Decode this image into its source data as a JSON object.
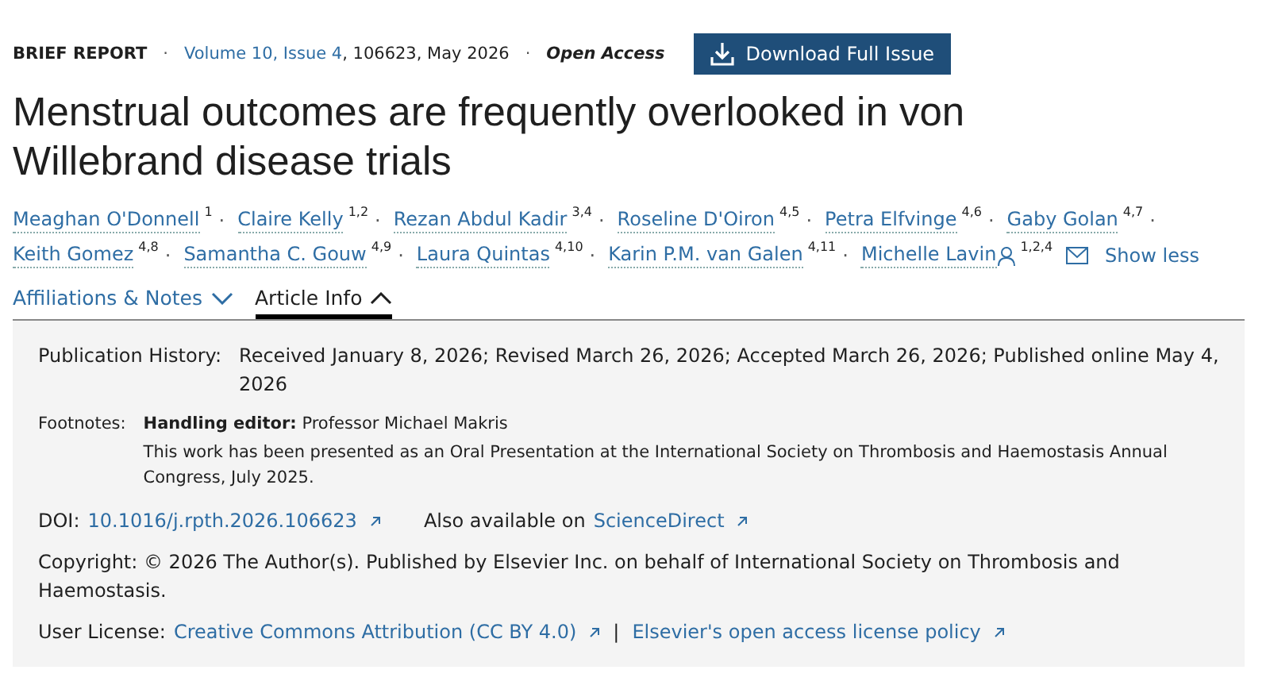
{
  "meta": {
    "type": "BRIEF REPORT",
    "separator": "·",
    "volume": "Volume 10, Issue 4",
    "details": ", 106623, May 2026",
    "access": "Open Access",
    "download_button": "Download Full Issue"
  },
  "title": "Menstrual outcomes are frequently overlooked in von Willebrand disease trials",
  "author_separator": "·",
  "authors": [
    {
      "kind": "author",
      "name": "Meaghan O'Donnell",
      "affiliations": "1"
    },
    {
      "kind": "author",
      "name": "Claire Kelly",
      "affiliations": "1,2"
    },
    {
      "kind": "author",
      "name": "Rezan Abdul Kadir",
      "affiliations": "3,4"
    },
    {
      "kind": "author",
      "name": "Roseline D'Oiron",
      "affiliations": "4,5"
    },
    {
      "kind": "author",
      "name": "Petra Elfvinge",
      "affiliations": "4,6"
    },
    {
      "kind": "author",
      "name": "Gaby Golan",
      "affiliations": "4,7"
    },
    {
      "kind": "author",
      "name": "Keith Gomez",
      "affiliations": "4,8"
    },
    {
      "kind": "author",
      "name": "Samantha C. Gouw",
      "affiliations": "4,9"
    },
    {
      "kind": "author",
      "name": "Laura Quintas",
      "affiliations": "4,10"
    },
    {
      "kind": "author",
      "name": "Karin P.M. van Galen",
      "affiliations": "4,11"
    },
    {
      "kind": "corresponding",
      "name": "Michelle Lavin",
      "affiliations": "1,2,4"
    }
  ],
  "show_less": "Show less",
  "tabs": [
    {
      "label": "Affiliations & Notes",
      "selected": false,
      "expanded": false
    },
    {
      "label": "Article Info",
      "selected": true,
      "expanded": true
    }
  ],
  "article_info": {
    "publication_history": {
      "label": "Publication History:",
      "value": "Received January 8, 2026; Revised March 26, 2026; Accepted March 26, 2026; Published online May 4, 2026"
    },
    "footnotes": {
      "label": "Footnotes:",
      "notes": [
        "**Handling editor:** Professor Michael Makris",
        "This work has been presented as an Oral Presentation at the International Society on Thrombosis and Haemostasis Annual Congress, July 2025."
      ]
    },
    "doi": {
      "label": "DOI:",
      "link": "10.1016/j.rpth.2026.106623",
      "also_text": "Also available on",
      "also_link": "ScienceDirect"
    },
    "copyright": {
      "label": "Copyright:",
      "value": "© 2026 The Author(s). Published by Elsevier Inc. on behalf of International Society on Thrombosis and Haemostasis."
    },
    "user_license": {
      "label": "User License:",
      "links": [
        "Creative Commons Attribution (CC BY 4.0)",
        "Elsevier's open access license policy"
      ],
      "separator": "|"
    }
  }
}
